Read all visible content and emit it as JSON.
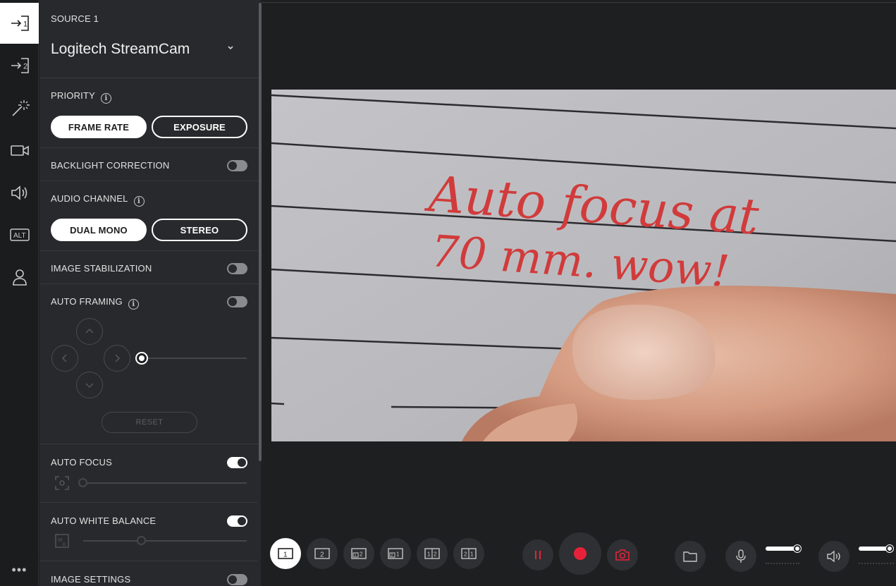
{
  "rail": {
    "items": [
      {
        "name": "source-1",
        "label": "1"
      },
      {
        "name": "source-2",
        "label": "2"
      },
      {
        "name": "effects"
      },
      {
        "name": "camera"
      },
      {
        "name": "audio"
      },
      {
        "name": "alt",
        "label": "ALT"
      },
      {
        "name": "account"
      }
    ],
    "more": "•••"
  },
  "panel": {
    "source_label": "SOURCE 1",
    "source_name": "Logitech StreamCam",
    "priority": {
      "label": "PRIORITY",
      "options": [
        "FRAME RATE",
        "EXPOSURE"
      ],
      "selected": "FRAME RATE"
    },
    "backlight_correction": {
      "label": "BACKLIGHT CORRECTION",
      "enabled": false
    },
    "audio_channel": {
      "label": "AUDIO CHANNEL",
      "options": [
        "DUAL MONO",
        "STEREO"
      ],
      "selected": "DUAL MONO"
    },
    "image_stabilization": {
      "label": "IMAGE STABILIZATION",
      "enabled": false
    },
    "auto_framing": {
      "label": "AUTO FRAMING",
      "enabled": false,
      "zoom_level": 0,
      "reset_label": "RESET"
    },
    "auto_focus": {
      "label": "AUTO FOCUS",
      "enabled": true,
      "focus_level": 0
    },
    "auto_white_balance": {
      "label": "AUTO WHITE BALANCE",
      "enabled": true,
      "wb_level": 0.5
    },
    "image_settings": {
      "label": "IMAGE SETTINGS",
      "enabled": false
    }
  },
  "preview": {
    "handwriting_line1": "Auto focus  at",
    "handwriting_line2": "70 mm.  wow!"
  },
  "toolbar": {
    "layouts": [
      {
        "name": "layout-1",
        "label": "1"
      },
      {
        "name": "layout-2",
        "label": "2"
      },
      {
        "name": "layout-1-2-pip",
        "label": "12"
      },
      {
        "name": "layout-2-1-pip",
        "label": "21"
      },
      {
        "name": "layout-1-2-split",
        "label": "12"
      },
      {
        "name": "layout-2-1-split",
        "label": "21"
      }
    ],
    "active_layout": "layout-1",
    "mic_volume": 0.9,
    "speaker_volume": 0.9,
    "accent_color": "#e8213a"
  }
}
